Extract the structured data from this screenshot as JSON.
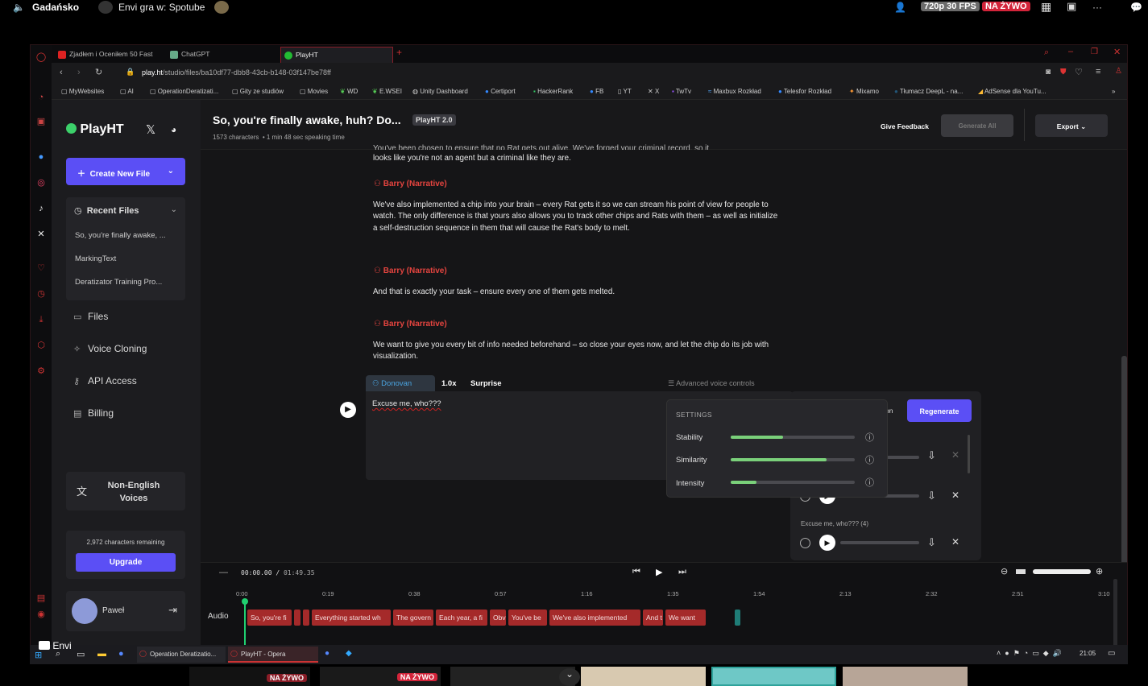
{
  "stream": {
    "channel": "Gadańsko",
    "now_playing": "Envi gra w: Spotube",
    "quality": "720p 30 FPS",
    "live": "NA ŻYWO",
    "more": "···",
    "chat_user": "Envi",
    "thumb_live1": "NA ŻYWO",
    "thumb_live2": "NA ŻYWO"
  },
  "browser": {
    "tabs": [
      {
        "label": "Zjadłem i Oceniłem 50 Fast",
        "color": "#d22"
      },
      {
        "label": "ChatGPT",
        "color": "#6a8"
      },
      {
        "label": "PlayHT",
        "color": "#2b3"
      }
    ],
    "url_host": "play.ht",
    "url_path": "/studio/files/ba10df77-dbb8-43cb-b148-03f147be78ff",
    "bookmarks": [
      "MyWebsites",
      "AI",
      "OperationDeratizati...",
      "Gity ze studiów",
      "Movies",
      "WD",
      "E.WSEI",
      "Unity Dashboard",
      "Certiport",
      "HackerRank",
      "FB",
      "YT",
      "X",
      "TwTv",
      "Maxbux Rozkład",
      "Telesfor Rozkład",
      "Mixamo",
      "Tłumacz DeepL - na...",
      "AdSense dla YouTu..."
    ]
  },
  "sidebar": {
    "logo": "PlayHT",
    "create_button": "Create New File",
    "recent_files_title": "Recent Files",
    "recent_files": [
      "So, you're finally awake, ...",
      "MarkingText",
      "Deratizator Training Pro..."
    ],
    "nav": [
      "Files",
      "Voice Cloning",
      "API Access",
      "Billing"
    ],
    "non_english": "Non-English Voices",
    "chars_remaining": "2,972 characters remaining",
    "upgrade": "Upgrade",
    "user": "Paweł"
  },
  "header": {
    "title": "So, you're finally awake, huh? Do...",
    "badge": "PlayHT 2.0",
    "meta_chars": "1573 characters",
    "meta_time": "• 1 min 48 sec speaking time",
    "feedback": "Give Feedback",
    "generate_all": "Generate All",
    "export": "Export"
  },
  "editor": {
    "top_line_cut": "You've been chosen to ensure that no Rat gets out alive. We've forged your criminal record, so it",
    "top_line2": "looks like you're not an agent but a criminal like they are.",
    "blocks": [
      {
        "speaker": "Barry (Narrative)",
        "text": "We've also implemented a chip into your brain – every Rat gets it so we can stream his point of view for people to watch. The only difference is that yours also allows you to track other chips and Rats with them – as well as initialize a self-destruction sequence in them that will cause the Rat's body to melt."
      },
      {
        "speaker": "Barry (Narrative)",
        "text": "And that is exactly your task – ensure every one of them gets melted."
      },
      {
        "speaker": "Barry (Narrative)",
        "text": "We want to give you every bit of info needed beforehand – so close your eyes now, and let the chip do its job with visualization."
      }
    ],
    "active_voice": "Donovan",
    "active_speed": "1.0x",
    "active_emotion": "Surprise",
    "advanced": "Advanced voice controls",
    "active_text": "Excuse me, who???",
    "regenerate": "Regenerate",
    "version_label": "Excuse me, who??? (4)",
    "partial_label": "on"
  },
  "settings": {
    "title": "SETTINGS",
    "sliders": [
      {
        "label": "Stability",
        "value": 0.42
      },
      {
        "label": "Similarity",
        "value": 0.77
      },
      {
        "label": "Intensity",
        "value": 0.21
      }
    ]
  },
  "timeline": {
    "current": "00:00.00",
    "total": "01:49.35",
    "ticks": [
      "0:00",
      "0:19",
      "0:38",
      "0:57",
      "1:16",
      "1:35",
      "1:54",
      "2:13",
      "2:32",
      "2:51",
      "3:10"
    ],
    "track_label": "Audio",
    "clips": [
      "So, you're fi",
      "",
      "",
      "Everything started wh",
      "The govern",
      "Each year, a fi",
      "Obv",
      "You've be",
      "We've also implemented",
      "And t",
      "We want"
    ]
  },
  "taskbar": {
    "items": [
      "Operation Deratizatio...",
      "PlayHT - Opera"
    ],
    "clock": "21:05"
  },
  "colors": {
    "accent": "#5b4ff5",
    "narrator": "#e4443f",
    "slider": "#7ad07a",
    "live": "#d3243a",
    "clip": "#a52a2a"
  }
}
